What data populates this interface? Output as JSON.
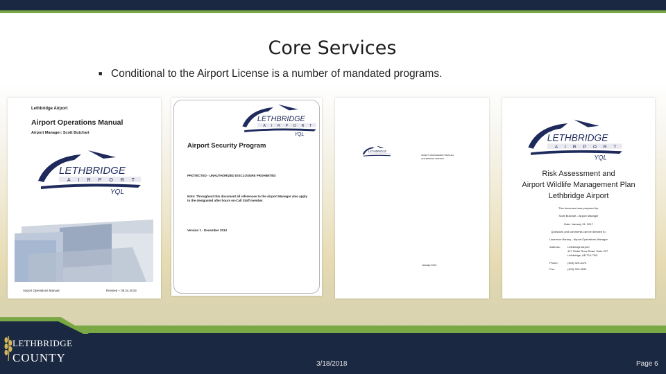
{
  "slide": {
    "title": "Core Services",
    "bullet": "Conditional to the Airport License is a number of mandated programs."
  },
  "documents": {
    "ops_manual": {
      "org": "Lethbridge Airport",
      "title": "Airport Operations Manual",
      "manager": "Airport Manager: Scott Butchart",
      "footer_left": "Airport Operations Manual",
      "footer_right": "Revised – 05.24.2016"
    },
    "security": {
      "title": "Airport Security Program",
      "protected": "PROTECTED - UNAUTHORIZED DISCLOSURE PROHIBITED",
      "note": "Note: Throughout this document all references to the Airport Manager also apply to the designated after hours on-Call Staff member.",
      "version": "Version 1 - December 2013"
    },
    "sms": {
      "header_line1": "SAFETY MANAGEMENT MANUAL",
      "header_line2": "LETHBRIDGE AIRPORT",
      "date": "January 2013"
    },
    "wildlife": {
      "title1": "Risk Assessment and",
      "title2": "Airport Wildlife Management Plan",
      "title3": "Lethbridge Airport",
      "prepared_by_label": "This document was prepared by:",
      "prepared_by": "Scott Butchart - Airport Manager",
      "date": "Date: January 31, 2017",
      "questions": "Questions and comments can be directed to:",
      "contact": "Lawrence Barany - Airport Operations Manager",
      "address_label": "Address:",
      "address_lines": [
        "Lethbridge Airport",
        "417 Stubb Ross Road, Suite 227",
        "Lethbridge, AB T1K 7N3"
      ],
      "phone_label": "Phone:",
      "phone": "(403) 329-4474",
      "fax_label": "Fax:",
      "fax": "(403) 329-4532"
    },
    "logo_text": {
      "name": "LETHBRIDGE",
      "sub": "AIRPORT",
      "code": "YQL"
    }
  },
  "footer": {
    "org_line1": "LETHBRIDGE",
    "org_line2": "COUNTY",
    "date": "3/18/2018",
    "page": "Page 6"
  },
  "colors": {
    "navy": "#1a2841",
    "green": "#7aa844",
    "logo_navy": "#1f2a5c",
    "logo_blue": "#2a6fb6"
  }
}
